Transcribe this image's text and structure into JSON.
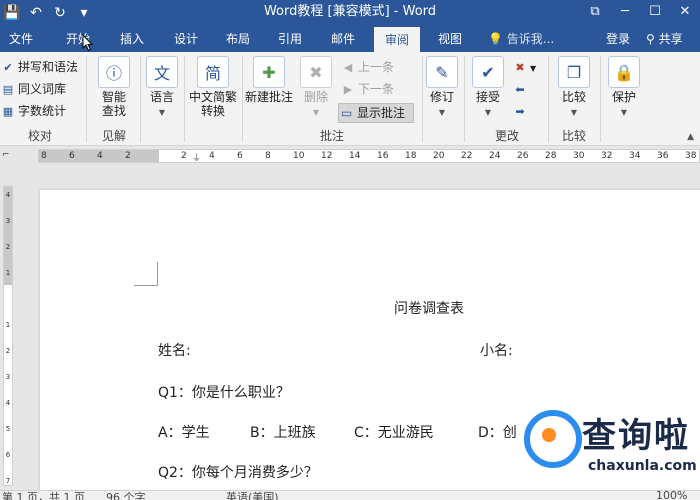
{
  "titlebar": {
    "title": "Word教程 [兼容模式] - Word",
    "qat": [
      "💾",
      "↶",
      "↻",
      "▾"
    ],
    "window_controls": [
      "⧉",
      "─",
      "☐",
      "✕"
    ]
  },
  "tabs": [
    "文件",
    "开始",
    "插入",
    "设计",
    "布局",
    "引用",
    "邮件",
    "审阅",
    "视图"
  ],
  "active_tab": "审阅",
  "tellme": "💡 告诉我...",
  "login": "登录",
  "share": "共享",
  "ribbon": {
    "proofing": {
      "spelling": "拼写和语法",
      "thesaurus": "同义词库",
      "word_count": "字数统计",
      "label": "校对"
    },
    "insights": {
      "smart_lookup": [
        "智能",
        "查找"
      ],
      "label": "见解"
    },
    "language": {
      "language": "语言"
    },
    "chinese": {
      "convert": [
        "中文简繁",
        "转换"
      ]
    },
    "comments": {
      "new_comment": "新建批注",
      "delete": "删除",
      "previous": "上一条",
      "next": "下一条",
      "show_comments": "显示批注",
      "label": "批注"
    },
    "tracking": {
      "track_changes": "修订"
    },
    "changes": {
      "accept": "接受",
      "label": "更改"
    },
    "compare": {
      "compare": "比较",
      "label": "比较"
    },
    "protect": {
      "protect": "保护"
    }
  },
  "ruler": {
    "ticks": [
      "8",
      "6",
      "4",
      "2",
      "",
      "2",
      "4",
      "6",
      "8",
      "10",
      "12",
      "14",
      "16",
      "18",
      "20",
      "22",
      "24",
      "26",
      "28",
      "30",
      "32",
      "34",
      "36",
      "38"
    ]
  },
  "document": {
    "title": "问卷调查表",
    "name_label": "姓名:",
    "nickname_label": "小名:",
    "q1": "Q1：你是什么职业？",
    "options": [
      "A：学生",
      "B：上班族",
      "C：无业游民",
      "D：创"
    ],
    "q2": "Q2：你每个月消费多少？"
  },
  "statusbar": {
    "page": "第 1 页，共 1 页",
    "words": "96 个字",
    "language": "英语(美国)",
    "zoom": "100%"
  },
  "watermark": {
    "title": "查询啦",
    "sub": "chaxunla.com"
  }
}
